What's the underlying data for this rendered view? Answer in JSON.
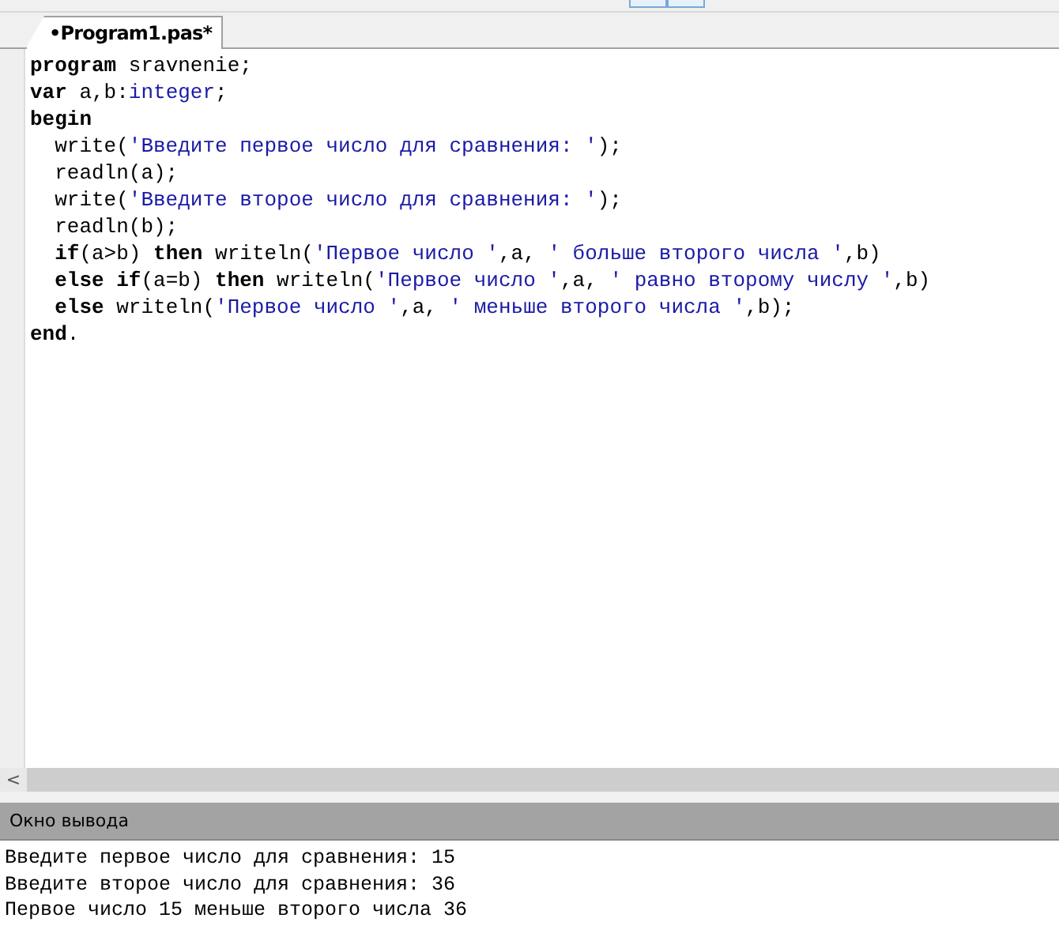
{
  "tabs": [
    {
      "label": "•Program1.pas*",
      "selected": true
    }
  ],
  "editor": {
    "lines": [
      {
        "indent": false,
        "segments": [
          {
            "kind": "kw",
            "text": "program"
          },
          {
            "kind": "plain",
            "text": " sravnenie;"
          }
        ]
      },
      {
        "indent": false,
        "segments": [
          {
            "kind": "kw",
            "text": "var"
          },
          {
            "kind": "plain",
            "text": " a,b:"
          },
          {
            "kind": "type",
            "text": "integer"
          },
          {
            "kind": "plain",
            "text": ";"
          }
        ]
      },
      {
        "indent": false,
        "segments": [
          {
            "kind": "kw",
            "text": "begin"
          }
        ]
      },
      {
        "indent": true,
        "segments": [
          {
            "kind": "plain",
            "text": "write("
          },
          {
            "kind": "str",
            "text": "'Введите первое число для сравнения: '"
          },
          {
            "kind": "plain",
            "text": ");"
          }
        ]
      },
      {
        "indent": true,
        "segments": [
          {
            "kind": "plain",
            "text": "readln(a);"
          }
        ]
      },
      {
        "indent": true,
        "segments": [
          {
            "kind": "plain",
            "text": "write("
          },
          {
            "kind": "str",
            "text": "'Введите второе число для сравнения: '"
          },
          {
            "kind": "plain",
            "text": ");"
          }
        ]
      },
      {
        "indent": true,
        "segments": [
          {
            "kind": "plain",
            "text": "readln(b);"
          }
        ]
      },
      {
        "indent": true,
        "segments": [
          {
            "kind": "kw",
            "text": "if"
          },
          {
            "kind": "plain",
            "text": "(a>b) "
          },
          {
            "kind": "kw",
            "text": "then"
          },
          {
            "kind": "plain",
            "text": " writeln("
          },
          {
            "kind": "str",
            "text": "'Первое число '"
          },
          {
            "kind": "plain",
            "text": ",a, "
          },
          {
            "kind": "str",
            "text": "' больше второго числа '"
          },
          {
            "kind": "plain",
            "text": ",b)"
          }
        ]
      },
      {
        "indent": true,
        "segments": [
          {
            "kind": "kw",
            "text": "else"
          },
          {
            "kind": "kw",
            "text": " if"
          },
          {
            "kind": "plain",
            "text": "(a=b) "
          },
          {
            "kind": "kw",
            "text": "then"
          },
          {
            "kind": "plain",
            "text": " writeln("
          },
          {
            "kind": "str",
            "text": "'Первое число '"
          },
          {
            "kind": "plain",
            "text": ",a, "
          },
          {
            "kind": "str",
            "text": "' равно второму числу '"
          },
          {
            "kind": "plain",
            "text": ",b)"
          }
        ]
      },
      {
        "indent": true,
        "segments": [
          {
            "kind": "kw",
            "text": "else"
          },
          {
            "kind": "plain",
            "text": " writeln("
          },
          {
            "kind": "str",
            "text": "'Первое число '"
          },
          {
            "kind": "plain",
            "text": ",a, "
          },
          {
            "kind": "str",
            "text": "' меньше второго числа '"
          },
          {
            "kind": "plain",
            "text": ",b);"
          }
        ]
      },
      {
        "indent": false,
        "segments": [
          {
            "kind": "kw",
            "text": "end"
          },
          {
            "kind": "plain",
            "text": "."
          }
        ]
      }
    ],
    "scroll_arrow": "<"
  },
  "output": {
    "title": "Окно вывода",
    "lines": [
      "Введите первое число для сравнения: 15",
      "Введите второе число для сравнения: 36",
      "Первое число 15 меньше второго числа 36"
    ]
  }
}
